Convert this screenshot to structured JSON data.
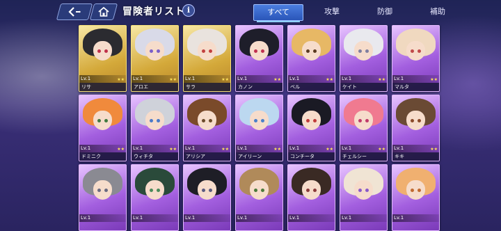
{
  "header": {
    "title": "冒険者リスト",
    "back_icon": "back-arrow-icon",
    "home_icon": "home-icon",
    "info_label": "i"
  },
  "tabs": [
    {
      "label": "すべて",
      "active": true
    },
    {
      "label": "攻撃",
      "active": false
    },
    {
      "label": "防御",
      "active": false
    },
    {
      "label": "補助",
      "active": false
    }
  ],
  "cards": [
    {
      "name": "リサ",
      "level": "Lv.1",
      "stars": "★★",
      "frame": "gold",
      "hair": "#2b2b30",
      "eye": "#c0304a"
    },
    {
      "name": "アロエ",
      "level": "Lv.1",
      "stars": "★★",
      "frame": "gold",
      "hair": "#d9dae8",
      "eye": "#7a5fc9"
    },
    {
      "name": "サラ",
      "level": "Lv.1",
      "stars": "★★",
      "frame": "gold",
      "hair": "#e9e3de",
      "eye": "#c24040"
    },
    {
      "name": "カノン",
      "level": "Lv.1",
      "stars": "★★",
      "frame": "purple",
      "hair": "#1e1e2a",
      "eye": "#c03050"
    },
    {
      "name": "ベル",
      "level": "Lv.1",
      "stars": "★★",
      "frame": "purple",
      "hair": "#e7b865",
      "eye": "#5a3a20"
    },
    {
      "name": "ケイト",
      "level": "Lv.1",
      "stars": "★★",
      "frame": "purple",
      "hair": "#e9e9ee",
      "eye": "#7f7fa0"
    },
    {
      "name": "マルタ",
      "level": "Lv.1",
      "stars": "★★",
      "frame": "purple",
      "hair": "#f0d9c0",
      "eye": "#c04a4a"
    },
    {
      "name": "ドミニク",
      "level": "Lv.1",
      "stars": "★★",
      "frame": "purple",
      "hair": "#f08a3c",
      "eye": "#3f7a3f"
    },
    {
      "name": "ウィチタ",
      "level": "Lv.1",
      "stars": "★★",
      "frame": "purple",
      "hair": "#cfd2da",
      "eye": "#4a7ac9"
    },
    {
      "name": "アリシア",
      "level": "Lv.1",
      "stars": "★★",
      "frame": "purple",
      "hair": "#7a4a2a",
      "eye": "#6a4a2a"
    },
    {
      "name": "アイリーン",
      "level": "Lv.1",
      "stars": "★★",
      "frame": "purple",
      "hair": "#bcd8f0",
      "eye": "#4a80c9"
    },
    {
      "name": "コンチータ",
      "level": "Lv.1",
      "stars": "★★",
      "frame": "purple",
      "hair": "#1a1a24",
      "eye": "#c03a3a"
    },
    {
      "name": "チェルシー",
      "level": "Lv.1",
      "stars": "★★",
      "frame": "purple",
      "hair": "#f07a90",
      "eye": "#c03a6a"
    },
    {
      "name": "キキ",
      "level": "Lv.1",
      "stars": "★★",
      "frame": "purple",
      "hair": "#6a4a34",
      "eye": "#8a4a2a"
    },
    {
      "name": "",
      "level": "Lv.1",
      "stars": "",
      "frame": "purple",
      "hair": "#8a8a92",
      "eye": "#6a6a80"
    },
    {
      "name": "",
      "level": "Lv.1",
      "stars": "",
      "frame": "purple",
      "hair": "#2a4a3a",
      "eye": "#4a8a5a"
    },
    {
      "name": "",
      "level": "Lv.1",
      "stars": "",
      "frame": "purple",
      "hair": "#1e1e26",
      "eye": "#5a5a80"
    },
    {
      "name": "",
      "level": "Lv.1",
      "stars": "",
      "frame": "purple",
      "hair": "#b08a5a",
      "eye": "#4a7a3a"
    },
    {
      "name": "",
      "level": "Lv.1",
      "stars": "",
      "frame": "purple",
      "hair": "#3a2a24",
      "eye": "#8a3a3a"
    },
    {
      "name": "",
      "level": "Lv.1",
      "stars": "",
      "frame": "purple",
      "hair": "#f0e4d4",
      "eye": "#8a5ac9"
    },
    {
      "name": "",
      "level": "Lv.1",
      "stars": "",
      "frame": "purple",
      "hair": "#f0b070",
      "eye": "#c06a30"
    }
  ]
}
